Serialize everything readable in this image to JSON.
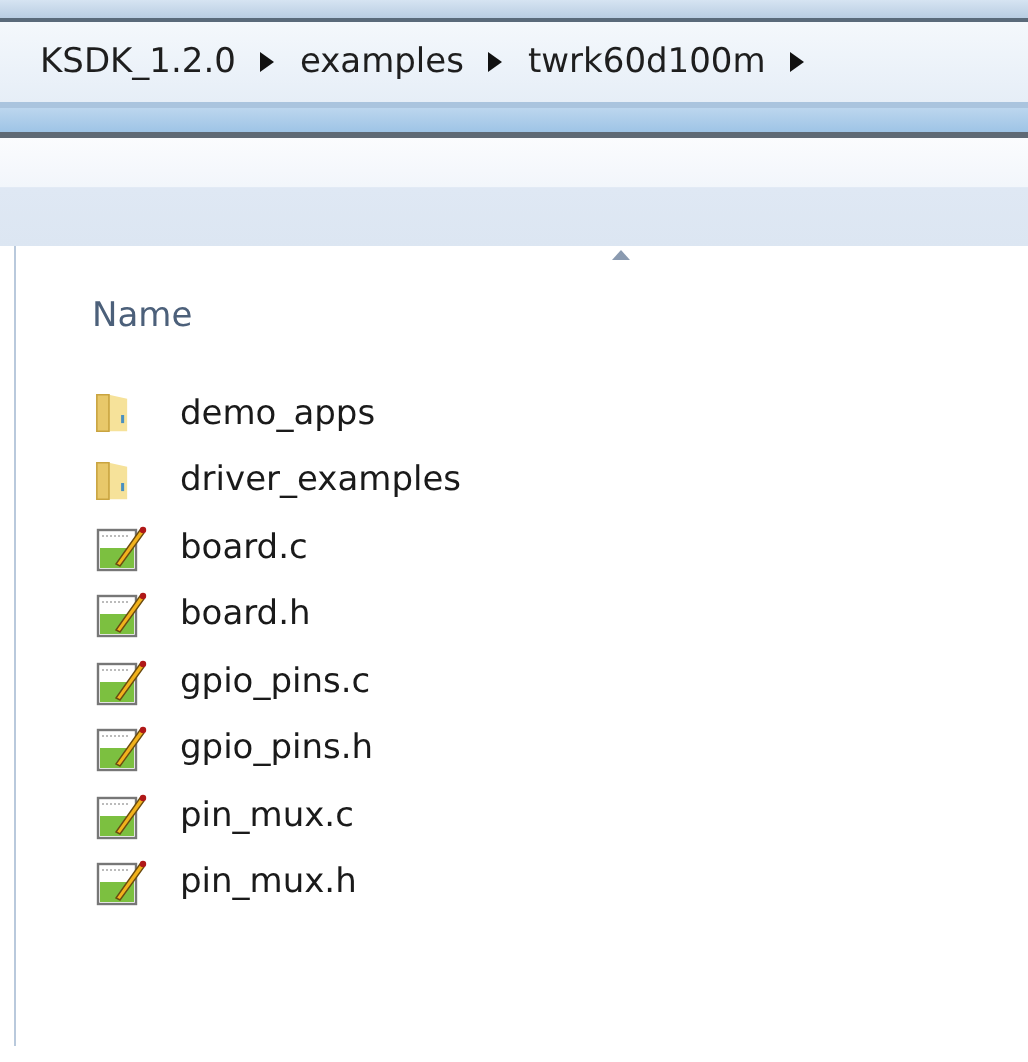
{
  "breadcrumb": [
    {
      "label": "KSDK_1.2.0"
    },
    {
      "label": "examples"
    },
    {
      "label": "twrk60d100m"
    }
  ],
  "column_header": {
    "label": "Name",
    "sorted": true
  },
  "items": [
    {
      "name": "demo_apps",
      "kind": "folder"
    },
    {
      "name": "driver_examples",
      "kind": "folder"
    },
    {
      "name": "board.c",
      "kind": "file"
    },
    {
      "name": "board.h",
      "kind": "file"
    },
    {
      "name": "gpio_pins.c",
      "kind": "file"
    },
    {
      "name": "gpio_pins.h",
      "kind": "file"
    },
    {
      "name": "pin_mux.c",
      "kind": "file"
    },
    {
      "name": "pin_mux.h",
      "kind": "file"
    }
  ]
}
